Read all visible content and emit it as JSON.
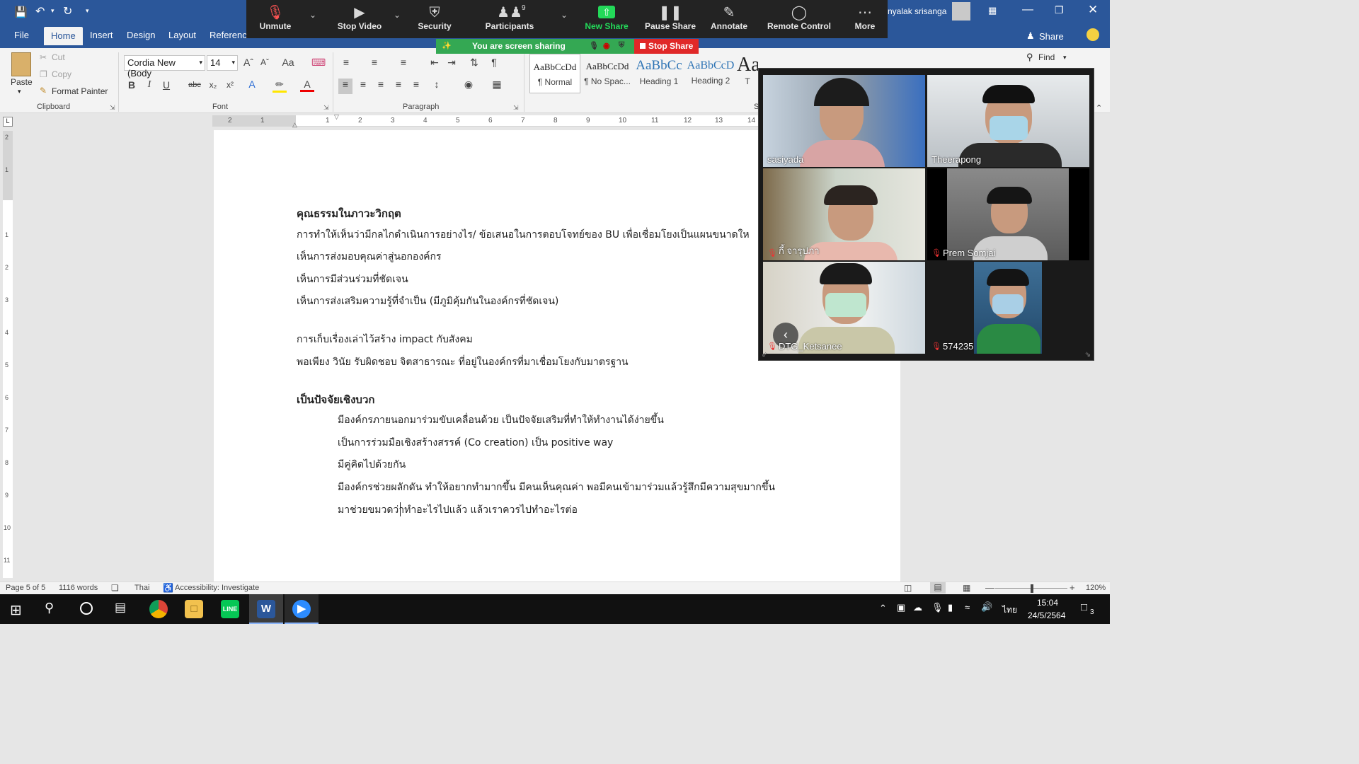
{
  "titlebar": {
    "user_name": "nyalak srisanga"
  },
  "tabs": [
    "File",
    "Home",
    "Insert",
    "Design",
    "Layout",
    "References"
  ],
  "ribbon_right": {
    "share": "Share",
    "find": "Find"
  },
  "clipboard": {
    "paste": "Paste",
    "cut": "Cut",
    "copy": "Copy",
    "format_painter": "Format Painter",
    "label": "Clipboard"
  },
  "font": {
    "name": "Cordia New (Body",
    "size": "14",
    "label": "Font",
    "case": "Aa"
  },
  "paragraph": {
    "label": "Paragraph"
  },
  "styles": [
    {
      "preview": "AaBbCcDd",
      "name": "¶ Normal"
    },
    {
      "preview": "AaBbCcDd",
      "name": "¶ No Spac..."
    },
    {
      "preview": "AaBbCc",
      "name": "Heading 1"
    },
    {
      "preview": "AaBbCcD",
      "name": "Heading 2"
    },
    {
      "preview": "AaB",
      "name": "T"
    }
  ],
  "styles_label": "S",
  "zoom": {
    "controls": [
      {
        "icon": "mic-muted-icon",
        "label": "Unmute"
      },
      {
        "icon": "video-icon",
        "label": "Stop Video"
      },
      {
        "icon": "shield-icon",
        "label": "Security"
      },
      {
        "icon": "participants-icon",
        "label": "Participants"
      },
      {
        "icon": "share-up-arrow-icon",
        "label": "New Share"
      },
      {
        "icon": "pause-icon",
        "label": "Pause Share"
      },
      {
        "icon": "pen-icon",
        "label": "Annotate"
      },
      {
        "icon": "mouse-icon",
        "label": "Remote Control"
      },
      {
        "icon": "more-dots-icon",
        "label": "More"
      }
    ],
    "participant_count": "9",
    "sharing_text": "You are screen sharing",
    "stop_share": "Stop Share",
    "new_share_color": "#23d959",
    "participants": [
      "sasiyada",
      "Theerapong",
      "กี้ จารุปภา",
      "Prem Somjai",
      "DTG_Ketsanee",
      "574235"
    ]
  },
  "ruler": {
    "ticks": [
      "2",
      "1",
      "1",
      "2",
      "3",
      "4",
      "5",
      "6",
      "7",
      "8",
      "9",
      "10",
      "11",
      "12",
      "13",
      "14"
    ]
  },
  "vruler": {
    "ticks": [
      "2",
      "1",
      "1",
      "2",
      "3",
      "4",
      "5",
      "6",
      "7",
      "8",
      "9",
      "10",
      "11"
    ]
  },
  "document": {
    "heading1": "คุณธรรมในภาวะวิกฤต",
    "lines1": [
      "การทำให้เห็นว่ามีกลไกดำเนินการอย่างไร/ ข้อเสนอในการตอบโจทย์ของ BU เพื่อเชื่อมโยงเป็นแผนขนาดให",
      "เห็นการส่งมอบคุณค่าสู่นอกองค์กร",
      "เห็นการมีส่วนร่วมที่ชัดเจน",
      "เห็นการส่งเสริมความรู้ที่จำเป็น (มีภูมิคุ้มกันในองค์กรที่ชัดเจน)"
    ],
    "lines2": [
      "การเก็บเรื่องเล่าไว้สร้าง impact กับสังคม",
      "พอเพียง วินัย รับผิดชอบ จิตสาธารณะ ที่อยู่ในองค์กรที่มาเชื่อมโยงกับมาตรฐาน"
    ],
    "heading2": "เป็นปัจจัยเชิงบวก",
    "lines3": [
      "มีองค์กรภายนอกมาร่วมขับเคลื่อนด้วย เป็นปัจจัยเสริมที่ทำให้ทำงานได้ง่ายขึ้น",
      "เป็นการร่วมมือเชิงสร้างสรรค์ (Co creation) เป็น positive way",
      "มีคู่คิดไปด้วยกัน",
      "มีองค์กรช่วยผลักดัน ทำให้อยากทำมากขึ้น มีคนเห็นคุณค่า พอมีคนเข้ามาร่วมแล้วรู้สึกมีความสุขมากขึ้น",
      "มาช่วยขมวดว่าทำอะไรไปแล้ว แล้วเราควรไปทำอะไรต่อ"
    ]
  },
  "status": {
    "page": "Page 5 of 5",
    "words": "1116 words",
    "language": "Thai",
    "accessibility": "Accessibility: Investigate",
    "zoom": "120%"
  },
  "taskbar": {
    "time": "15:04",
    "date": "24/5/2564",
    "lang": "ไทย",
    "notif_count": "3"
  }
}
